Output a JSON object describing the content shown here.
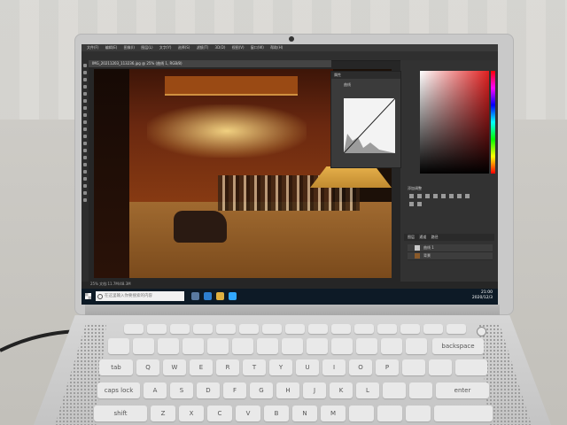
{
  "photoshop": {
    "menu": [
      "文件(F)",
      "编辑(E)",
      "图像(I)",
      "图层(L)",
      "文字(Y)",
      "选择(S)",
      "滤镜(T)",
      "3D(D)",
      "视图(V)",
      "窗口(W)",
      "帮助(H)"
    ],
    "document_tab": "IMG_20211203_113236.jpg @ 25% (曲线 1, RGB/8)",
    "status": "25% 文档:11.7M/48.3M",
    "properties_panel": {
      "title": "属性",
      "preset_label": "曲线"
    },
    "adjustments_label": "添加调整",
    "layers_tabs": [
      "图层",
      "通道",
      "路径"
    ],
    "layers": [
      "曲线 1",
      "背景"
    ]
  },
  "taskbar": {
    "search_placeholder": "在这里输入你要搜索的内容",
    "time": "21:00",
    "date": "2020/12/3"
  },
  "keyboard": {
    "backspace": "backspace",
    "tab": "tab",
    "caps": "caps lock",
    "shift": "shift",
    "row_q": [
      "Q",
      "W",
      "E",
      "R",
      "T",
      "Y",
      "U",
      "I",
      "O",
      "P"
    ],
    "row_a": [
      "A",
      "S",
      "D",
      "F",
      "G",
      "H",
      "J",
      "K",
      "L"
    ],
    "row_z": [
      "Z",
      "X",
      "C",
      "V",
      "B",
      "N",
      "M"
    ],
    "enter": "enter"
  },
  "colors": {
    "accent_hue_top": "#ff0000",
    "taskbar": "#0d1a26",
    "ps_bg": "#323232"
  }
}
